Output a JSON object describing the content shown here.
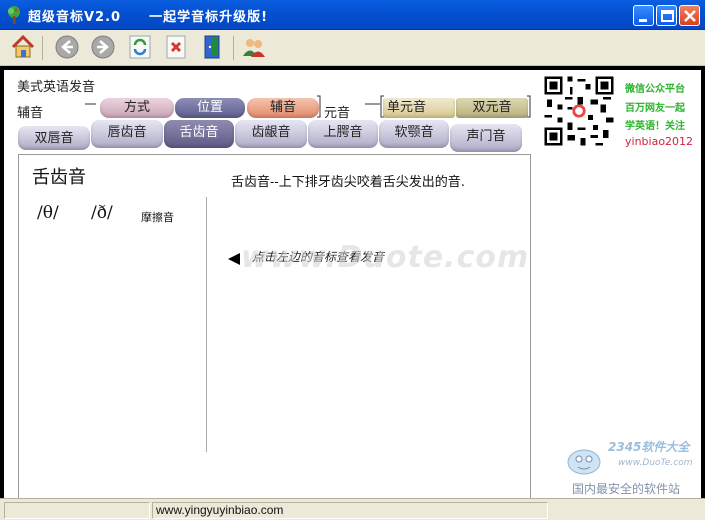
{
  "window": {
    "title": "超级音标V2.0　　一起学音标升级版!"
  },
  "toolbar": {
    "buttons": [
      {
        "name": "home-button",
        "icon": "home-icon"
      },
      {
        "name": "back-button",
        "icon": "arrow-left-icon"
      },
      {
        "name": "forward-button",
        "icon": "arrow-right-icon"
      },
      {
        "name": "refresh-button",
        "icon": "refresh-icon"
      },
      {
        "name": "stop-button",
        "icon": "stop-icon"
      },
      {
        "name": "exit-button",
        "icon": "exit-door-icon"
      },
      {
        "name": "users-button",
        "icon": "users-icon"
      }
    ]
  },
  "header": {
    "section_title": "美式英语发音",
    "consonant_label": "辅音",
    "vowel_label": "元音",
    "consonant_pills": [
      "方式",
      "位置",
      "辅音"
    ],
    "vowel_pills": [
      "单元音",
      "双元音"
    ]
  },
  "tabs": [
    "双唇音",
    "唇齿音",
    "舌齿音",
    "齿龈音",
    "上腭音",
    "软颚音",
    "声门音"
  ],
  "active_tab": "舌齿音",
  "panel": {
    "heading": "舌齿音",
    "description": "舌齿音--上下排牙齿尖咬着舌尖发出的音.",
    "symbols": [
      "/θ/",
      "/ð/"
    ],
    "symbol_type": "摩擦音",
    "hint": "点击左边的音标查看发音"
  },
  "promo": {
    "lines": [
      "微信公众平台",
      "百万网友一起",
      "学英语！关注"
    ],
    "account": "yinbiao2012"
  },
  "watermark": {
    "text": "www.Duote.com",
    "corner_line1": "2345软件大全",
    "corner_line2": "www.DuoTe.com",
    "corner_line3": "国内最安全的软件站"
  },
  "statusbar": {
    "url": "www.yingyuyinbiao.com"
  },
  "colors": {
    "titlebar": "#0450d0",
    "pill_way": "#d8b7c9",
    "pill_position": "#6a6a9a",
    "pill_consonant": "#e89b7a",
    "pill_monophthong": "#e2d7a6",
    "pill_diphthong": "#c3bd8c",
    "promo_green": "#2db52d",
    "promo_red": "#d2213b"
  }
}
